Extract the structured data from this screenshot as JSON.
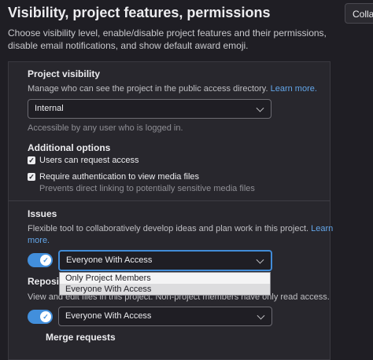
{
  "header": {
    "title": "Visibility, project features, permissions",
    "collapse_label": "Collapse",
    "description": "Choose visibility level, enable/disable project features and their permissions, disable email notifications, and show default award emoji."
  },
  "project_visibility": {
    "heading": "Project visibility",
    "description": "Manage who can see the project in the public access directory.",
    "learn_more": "Learn more.",
    "selected": "Internal",
    "help": "Accessible by any user who is logged in."
  },
  "additional_options": {
    "heading": "Additional options",
    "options": [
      {
        "label": "Users can request access",
        "checked": true
      },
      {
        "label": "Require authentication to view media files",
        "checked": true,
        "hint": "Prevents direct linking to potentially sensitive media files"
      }
    ]
  },
  "issues": {
    "heading": "Issues",
    "description_line1": "Flexible tool to collaboratively develop ideas and plan work in this project.",
    "learn_more_part1": "Learn",
    "learn_more_part2": "more.",
    "enabled": true,
    "selected": "Everyone With Access"
  },
  "dropdown_menu": {
    "options": [
      "Only Project Members",
      "Everyone With Access"
    ],
    "highlighted_index": 1
  },
  "repository": {
    "heading_visible": "Reposito",
    "description_visible": "View and edit files in this project. Non-project members have only read access.",
    "enabled": true,
    "selected": "Everyone With Access"
  },
  "merge_requests": {
    "heading": "Merge requests"
  },
  "colors": {
    "background": "#1f1e24",
    "panel": "#28272d",
    "accent": "#428fdc",
    "link": "#63a6e9"
  }
}
